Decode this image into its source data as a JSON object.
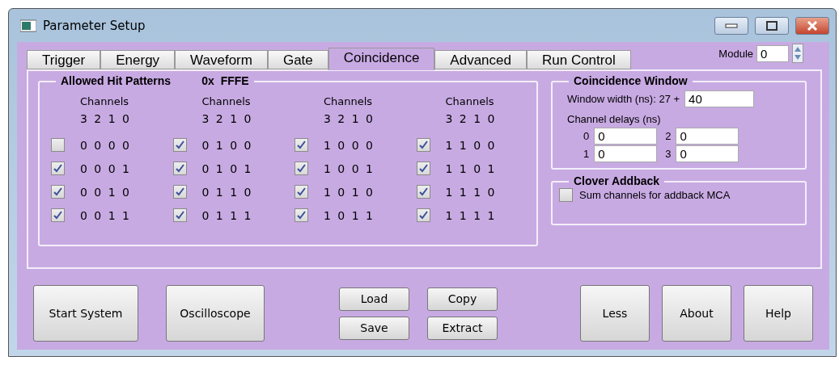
{
  "window": {
    "title": "Parameter Setup"
  },
  "tabs": [
    {
      "label": "Trigger",
      "selected": false
    },
    {
      "label": "Energy",
      "selected": false
    },
    {
      "label": "Waveform",
      "selected": false
    },
    {
      "label": "Gate",
      "selected": false
    },
    {
      "label": "Coincidence",
      "selected": true
    },
    {
      "label": "Advanced",
      "selected": false
    },
    {
      "label": "Run Control",
      "selected": false
    }
  ],
  "module": {
    "label": "Module",
    "value": "0"
  },
  "hit_patterns": {
    "title": "Allowed Hit Patterns",
    "hex_prefix": "0x",
    "hex_value": "FFFE",
    "groups": [
      {
        "heading": "Channels",
        "bits_header": "3 2 1 0",
        "rows": [
          {
            "checked": false,
            "bits": "0 0 0 0"
          },
          {
            "checked": true,
            "bits": "0 0 0 1"
          },
          {
            "checked": true,
            "bits": "0 0 1 0"
          },
          {
            "checked": true,
            "bits": "0 0 1 1"
          }
        ]
      },
      {
        "heading": "Channels",
        "bits_header": "3 2 1 0",
        "rows": [
          {
            "checked": true,
            "bits": "0 1 0 0"
          },
          {
            "checked": true,
            "bits": "0 1 0 1"
          },
          {
            "checked": true,
            "bits": "0 1 1 0"
          },
          {
            "checked": true,
            "bits": "0 1 1 1"
          }
        ]
      },
      {
        "heading": "Channels",
        "bits_header": "3 2 1 0",
        "rows": [
          {
            "checked": true,
            "bits": "1 0 0 0"
          },
          {
            "checked": true,
            "bits": "1 0 0 1"
          },
          {
            "checked": true,
            "bits": "1 0 1 0"
          },
          {
            "checked": true,
            "bits": "1 0 1 1"
          }
        ]
      },
      {
        "heading": "Channels",
        "bits_header": "3 2 1 0",
        "rows": [
          {
            "checked": true,
            "bits": "1 1 0 0"
          },
          {
            "checked": true,
            "bits": "1 1 0 1"
          },
          {
            "checked": true,
            "bits": "1 1 1 0"
          },
          {
            "checked": true,
            "bits": "1 1 1 1"
          }
        ]
      }
    ]
  },
  "coincidence_window": {
    "title": "Coincidence Window",
    "width_label": "Window width (ns): 27 +",
    "width_value": "40",
    "delays_label": "Channel delays (ns)",
    "delays": [
      {
        "channel": "0",
        "value": "0"
      },
      {
        "channel": "2",
        "value": "0"
      },
      {
        "channel": "1",
        "value": "0"
      },
      {
        "channel": "3",
        "value": "0"
      }
    ]
  },
  "clover_addback": {
    "title": "Clover Addback",
    "option": {
      "label": "Sum channels for addback MCA",
      "checked": false
    }
  },
  "buttons": {
    "left": [
      "Start System",
      "Oscilloscope"
    ],
    "middle": [
      "Load",
      "Copy",
      "Save",
      "Extract"
    ],
    "right": [
      "Less",
      "About",
      "Help"
    ]
  }
}
